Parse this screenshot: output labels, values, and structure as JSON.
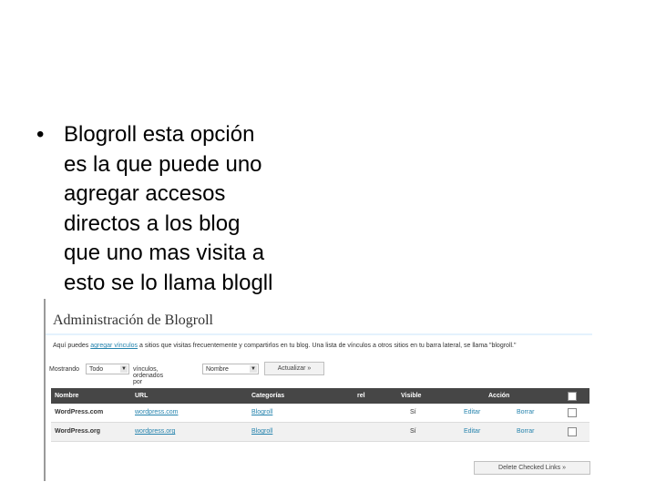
{
  "slide": {
    "bullet": "•",
    "text": "Blogroll esta opción\nes la que puede uno\nagregar accesos\ndirectos a los blog\nque uno mas visita a\nesto se lo llama blogll"
  },
  "admin": {
    "title": "Administración de Blogroll",
    "intro_before": "Aquí puedes ",
    "intro_link": "agregar vínculos",
    "intro_after": " a sitios que visitas frecuentemente y compartirlos en tu blog. Una lista de vínculos a otros sitios en tu barra lateral, se llama \"blogroll.\"",
    "show_label": "Mostrando",
    "category_value": "Todo",
    "ordered_label": "vínculos, ordenados por",
    "order_value": "Nombre",
    "update_button": "Actualizar »",
    "columns": {
      "name": "Nombre",
      "url": "URL",
      "categories": "Categorías",
      "rel": "rel",
      "visible": "Visible",
      "action": "Acción"
    },
    "rows": [
      {
        "name": "WordPress.com",
        "url": "wordpress.com",
        "category": "Blogroll",
        "rel": "",
        "visible": "Sí",
        "edit": "Editar",
        "delete": "Borrar"
      },
      {
        "name": "WordPress.org",
        "url": "wordpress.org",
        "category": "Blogroll",
        "rel": "",
        "visible": "Sí",
        "edit": "Editar",
        "delete": "Borrar"
      }
    ],
    "delete_checked_button": "Delete Checked Links »"
  }
}
